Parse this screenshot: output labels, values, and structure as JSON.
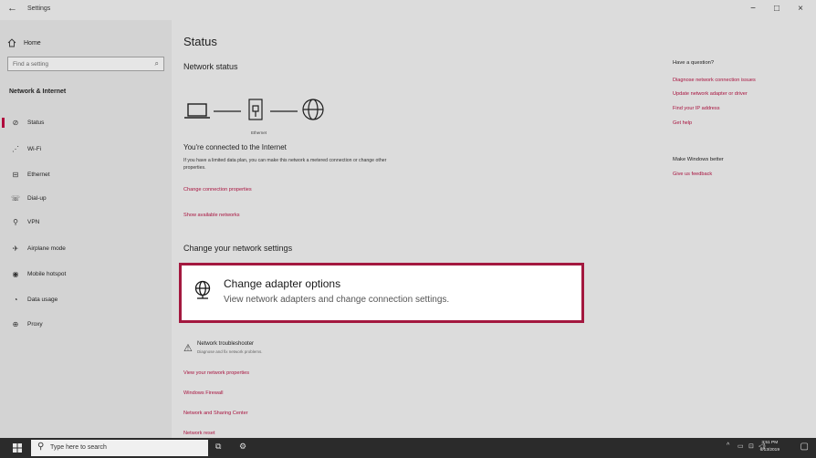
{
  "window": {
    "back_glyph": "←",
    "title": "Settings",
    "controls": {
      "minimize": "−",
      "maximize": "□",
      "close": "×"
    }
  },
  "sidebar": {
    "home": {
      "icon": "home-icon",
      "label": "Home"
    },
    "search_placeholder": "Find a setting",
    "section": "Network & Internet",
    "items": [
      {
        "icon": "status-icon",
        "glyph": "⊘",
        "label": "Status",
        "active": true
      },
      {
        "icon": "wifi-icon",
        "glyph": "⋰",
        "label": "Wi-Fi"
      },
      {
        "icon": "ethernet-icon",
        "glyph": "⊟",
        "label": "Ethernet"
      },
      {
        "icon": "dialup-icon",
        "glyph": "☏",
        "label": "Dial-up"
      },
      {
        "icon": "vpn-icon",
        "glyph": "⚲",
        "label": "VPN"
      },
      {
        "icon": "airplane-icon",
        "glyph": "✈",
        "label": "Airplane mode"
      },
      {
        "icon": "hotspot-icon",
        "glyph": "◉",
        "label": "Mobile hotspot"
      },
      {
        "icon": "data-usage-icon",
        "glyph": "◔",
        "label": "Data usage"
      },
      {
        "icon": "proxy-icon",
        "glyph": "⊕",
        "label": "Proxy"
      }
    ]
  },
  "main": {
    "title": "Status",
    "network_status": "Network status",
    "ethernet_label": "Ethernet",
    "connected_heading": "You're connected to the Internet",
    "connected_text": "If you have a limited data plan, you can make this network a metered connection or change other properties.",
    "change_connection": "Change connection properties",
    "show_networks": "Show available networks",
    "change_settings_heading": "Change your network settings",
    "adapter": {
      "title": "Change adapter options",
      "subtitle": "View network adapters and change connection settings."
    },
    "troubleshooter": {
      "title": "Network troubleshooter",
      "subtitle": "Diagnose and fix network problems."
    },
    "links": [
      "View your network properties",
      "Windows Firewall",
      "Network and Sharing Center",
      "Network reset"
    ]
  },
  "right": {
    "question": "Have a question?",
    "help_links": [
      "Diagnose network connection issues",
      "Update network adapter or driver",
      "Find your IP address",
      "Get help"
    ],
    "better": "Make Windows better",
    "feedback": "Give us feedback"
  },
  "taskbar": {
    "search_placeholder": "Type here to search",
    "time": "3:51 PM",
    "date": "6/13/2019"
  },
  "colors": {
    "accent": "#a8123e",
    "highlight_border": "#a3183f"
  }
}
